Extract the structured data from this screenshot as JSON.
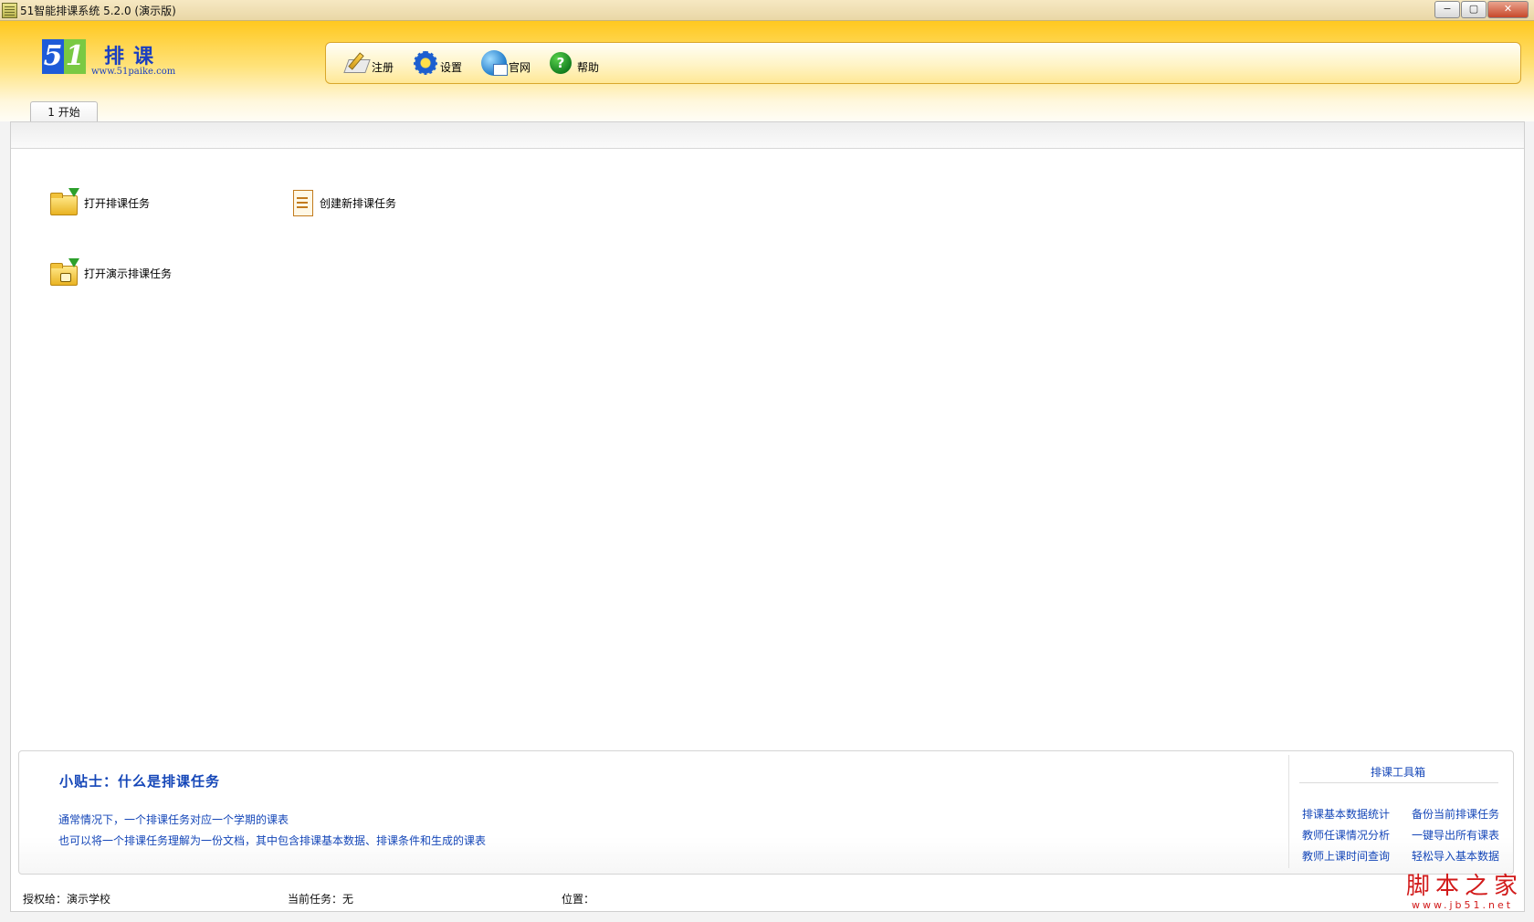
{
  "window": {
    "title": "51智能排课系统 5.2.0 (演示版)",
    "controls": {
      "minimize": "−",
      "maximize": "▢",
      "close": "✕"
    }
  },
  "logo": {
    "digit_5": "5",
    "digit_1": "1",
    "name": "排课",
    "url": "www.51paike.com"
  },
  "toolbar": {
    "register_label": "注册",
    "settings_label": "设置",
    "website_label": "官网",
    "help_label": "帮助",
    "help_glyph": "?"
  },
  "tabs": [
    {
      "label": "1 开始"
    }
  ],
  "actions": {
    "open_task": "打开排课任务",
    "create_task": "创建新排课任务",
    "open_demo_task": "打开演示排课任务"
  },
  "tips": {
    "title": "小贴士：什么是排课任务",
    "line1": "通常情况下，一个排课任务对应一个学期的课表",
    "line2": "也可以将一个排课任务理解为一份文档，其中包含排课基本数据、排课条件和生成的课表"
  },
  "toolbox": {
    "title": "排课工具箱",
    "links": [
      "排课基本数据统计",
      "备份当前排课任务",
      "教师任课情况分析",
      "一键导出所有课表",
      "教师上课时间查询",
      "轻松导入基本数据"
    ]
  },
  "status": {
    "licensed": "授权给：演示学校",
    "current_task": "当前任务：无",
    "location": "位置："
  },
  "watermark": {
    "brand": "脚本之家",
    "url": "www.jb51.net"
  }
}
